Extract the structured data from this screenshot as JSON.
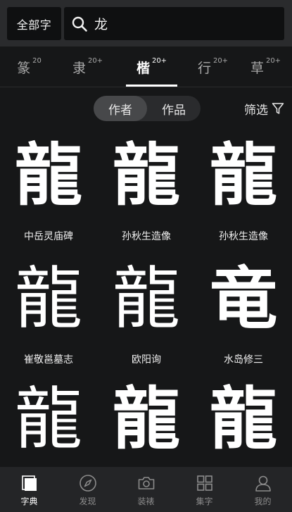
{
  "header": {
    "scope_label": "全部字",
    "search_value": "龙"
  },
  "tabs": [
    {
      "char": "篆",
      "count": "20"
    },
    {
      "char": "隶",
      "count": "20+"
    },
    {
      "char": "楷",
      "count": "20+",
      "active": true
    },
    {
      "char": "行",
      "count": "20+"
    },
    {
      "char": "草",
      "count": "20+"
    }
  ],
  "segment": {
    "author_label": "作者",
    "work_label": "作品",
    "selected": "作者"
  },
  "filter_label": "筛选",
  "results": [
    {
      "glyph": "龍",
      "name": "中岳灵庙碑"
    },
    {
      "glyph": "龍",
      "name": "孙秋生造像"
    },
    {
      "glyph": "龍",
      "name": "孙秋生造像"
    },
    {
      "glyph": "龍",
      "name": "崔敬邕墓志"
    },
    {
      "glyph": "龍",
      "name": "欧阳询"
    },
    {
      "glyph": "竜",
      "name": "水岛修三"
    },
    {
      "glyph": "龍",
      "name": ""
    },
    {
      "glyph": "龍",
      "name": ""
    },
    {
      "glyph": "龍",
      "name": ""
    }
  ],
  "bottom_nav": [
    {
      "label": "字典",
      "icon": "book-icon",
      "active": true
    },
    {
      "label": "发现",
      "icon": "compass-icon"
    },
    {
      "label": "装裱",
      "icon": "camera-icon"
    },
    {
      "label": "集字",
      "icon": "grid-icon"
    },
    {
      "label": "我的",
      "icon": "user-icon"
    }
  ]
}
